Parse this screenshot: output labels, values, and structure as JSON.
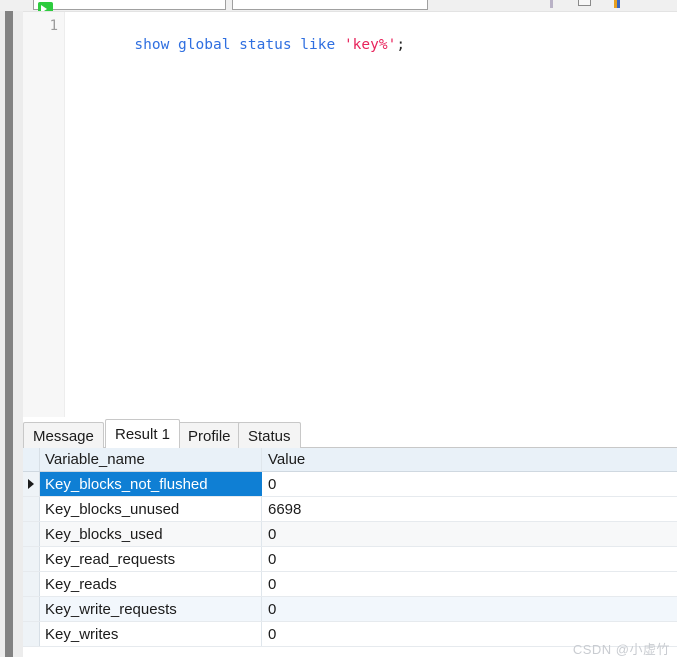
{
  "toolbar": {
    "connection_combo_value": "",
    "database_combo_value": "",
    "run_icon": "run-green-icon"
  },
  "editor": {
    "line_numbers": [
      "1"
    ],
    "sql_tokens": [
      {
        "text": "show",
        "type": "keyword"
      },
      {
        "text": " ",
        "type": "plain"
      },
      {
        "text": "global",
        "type": "keyword"
      },
      {
        "text": " ",
        "type": "plain"
      },
      {
        "text": "status",
        "type": "keyword"
      },
      {
        "text": " ",
        "type": "plain"
      },
      {
        "text": "like",
        "type": "keyword"
      },
      {
        "text": " ",
        "type": "plain"
      },
      {
        "text": "'key%'",
        "type": "string"
      },
      {
        "text": ";",
        "type": "punctuation"
      }
    ],
    "sql_text": "show global status like 'key%';"
  },
  "results": {
    "tabs": [
      {
        "label": "Message",
        "active": false
      },
      {
        "label": "Result 1",
        "active": true
      },
      {
        "label": "Profile",
        "active": false
      },
      {
        "label": "Status",
        "active": false
      }
    ],
    "columns": [
      "Variable_name",
      "Value"
    ],
    "rows": [
      {
        "variable_name": "Key_blocks_not_flushed",
        "value": "0",
        "selected": true
      },
      {
        "variable_name": "Key_blocks_unused",
        "value": "6698",
        "selected": false
      },
      {
        "variable_name": "Key_blocks_used",
        "value": "0",
        "selected": false
      },
      {
        "variable_name": "Key_read_requests",
        "value": "0",
        "selected": false
      },
      {
        "variable_name": "Key_reads",
        "value": "0",
        "selected": false
      },
      {
        "variable_name": "Key_write_requests",
        "value": "0",
        "selected": false
      },
      {
        "variable_name": "Key_writes",
        "value": "0",
        "selected": false
      }
    ]
  },
  "watermark": {
    "text": "CSDN @小虚竹"
  },
  "colors": {
    "selection_blue": "#0f7fd4",
    "keyword_blue": "#2f6fe0",
    "string_red": "#e8245c",
    "header_blue": "#e9f1f8",
    "run_green": "#2ecc3f"
  }
}
